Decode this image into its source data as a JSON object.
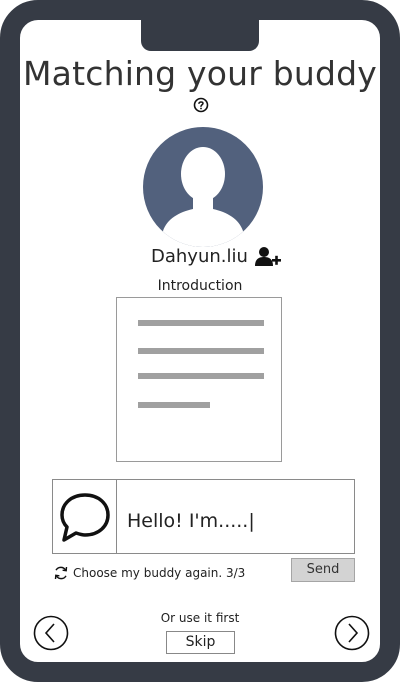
{
  "header": {
    "title": "Matching your buddy"
  },
  "profile": {
    "username": "Dahyun.liu",
    "intro_label": "Introduction"
  },
  "chat": {
    "message": "Hello! I'm.....|"
  },
  "rematch": {
    "label": "Choose my buddy again. 3/3"
  },
  "actions": {
    "send_label": "Send",
    "or_use_label": "Or use it first",
    "skip_label": "Skip"
  },
  "icons": {
    "help": "question-circle-icon",
    "avatar": "user-avatar-icon",
    "add_user": "add-user-icon",
    "chat": "speech-bubble-icon",
    "refresh": "refresh-icon",
    "prev": "chevron-left-icon",
    "next": "chevron-right-icon"
  },
  "colors": {
    "frame": "#363b45",
    "avatar_bg": "#52617d",
    "button_gray": "#d3d3d3"
  }
}
